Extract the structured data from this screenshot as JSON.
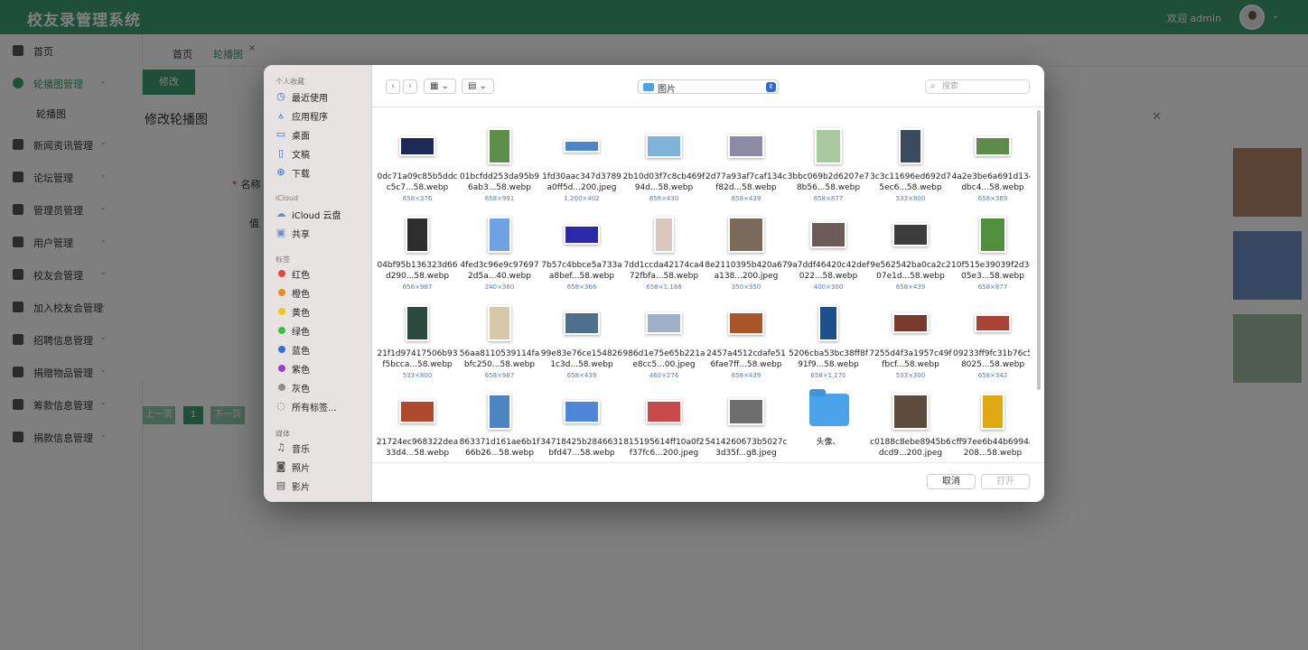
{
  "header": {
    "title": "校友录管理系统",
    "welcome": "欢迎 admin"
  },
  "sidebar": {
    "items": [
      {
        "label": "首页",
        "icon": "home-icon"
      },
      {
        "label": "轮播图管理",
        "icon": "circle-plus-icon",
        "active": true
      },
      {
        "label": "新闻资讯管理",
        "icon": "table-icon"
      },
      {
        "label": "论坛管理",
        "icon": "briefcase-icon"
      },
      {
        "label": "管理员管理",
        "icon": "bar-chart-icon"
      },
      {
        "label": "用户管理",
        "icon": "card-icon"
      },
      {
        "label": "校友会管理",
        "icon": "grid-icon"
      },
      {
        "label": "加入校友会管理",
        "icon": "mail-icon"
      },
      {
        "label": "招聘信息管理",
        "icon": "compass-icon"
      },
      {
        "label": "捐赠物品管理",
        "icon": "book-icon"
      },
      {
        "label": "筹款信息管理",
        "icon": "table-icon"
      },
      {
        "label": "捐款信息管理",
        "icon": "table-icon"
      }
    ],
    "sub_item": "轮播图"
  },
  "tabs": [
    {
      "label": "首页"
    },
    {
      "label": "轮播图"
    }
  ],
  "edit_button": "修改",
  "pager": {
    "prev": "上一页",
    "page": "1",
    "next": "下一页"
  },
  "edit_dialog": {
    "title": "修改轮播图",
    "name_label": "名称",
    "value_label": "值"
  },
  "picker": {
    "sections": {
      "favorites": "个人收藏",
      "icloud": "iCloud",
      "tags": "标签",
      "media": "媒体"
    },
    "favorites": [
      {
        "label": "最近使用",
        "icon": "clock-icon"
      },
      {
        "label": "应用程序",
        "icon": "apps-icon"
      },
      {
        "label": "桌面",
        "icon": "desktop-icon"
      },
      {
        "label": "文稿",
        "icon": "document-icon"
      },
      {
        "label": "下载",
        "icon": "download-icon"
      }
    ],
    "icloud": [
      {
        "label": "iCloud 云盘",
        "icon": "cloud-icon"
      },
      {
        "label": "共享",
        "icon": "shared-folder-icon"
      }
    ],
    "tags": [
      {
        "label": "红色",
        "color": "#e8453c"
      },
      {
        "label": "橙色",
        "color": "#f08a1c"
      },
      {
        "label": "黄色",
        "color": "#f2c811"
      },
      {
        "label": "绿色",
        "color": "#3cc13b"
      },
      {
        "label": "蓝色",
        "color": "#2f6fe0"
      },
      {
        "label": "紫色",
        "color": "#9a3fc9"
      },
      {
        "label": "灰色",
        "color": "#8e8e8e"
      },
      {
        "label": "所有标签...",
        "color": ""
      }
    ],
    "media": [
      {
        "label": "音乐",
        "icon": "music-icon"
      },
      {
        "label": "照片",
        "icon": "camera-icon"
      },
      {
        "label": "影片",
        "icon": "film-icon"
      }
    ],
    "location": "图片",
    "search_placeholder": "搜索",
    "cancel": "取消",
    "open": "打开",
    "files": [
      {
        "name": "0dc71a09c85b5ddcc5c7...58.webp",
        "dims": "658×376",
        "color": "#1e2a55"
      },
      {
        "name": "01bcfdd253da95b96ab3...58.webp",
        "dims": "658×991",
        "color": "#5d8f4a"
      },
      {
        "name": "1fd30aac347d3789a0ff5d...200.jpeg",
        "dims": "1,200×402",
        "color": "#4c86c9"
      },
      {
        "name": "2b10d03f7c8cb469f94d...58.webp",
        "dims": "658×430",
        "color": "#7fb3d8"
      },
      {
        "name": "2d77a93af7caf134cf82d...58.webp",
        "dims": "658×439",
        "color": "#8c8aa6"
      },
      {
        "name": "3bbc069b2d6207e78b56...58.webp",
        "dims": "658×877",
        "color": "#a8c9a0"
      },
      {
        "name": "3c3c11696ed692d75ec6...58.webp",
        "dims": "533×800",
        "color": "#3b4a5c"
      },
      {
        "name": "4a2e3be6a691d134dbc4...58.webp",
        "dims": "658×369",
        "color": "#5e8a4c"
      },
      {
        "name": "04bf95b136323d66d290...58.webp",
        "dims": "658×987",
        "color": "#2d2d2d"
      },
      {
        "name": "4fed3c96e9c976972d5a...40.webp",
        "dims": "240×360",
        "color": "#6fa2e4"
      },
      {
        "name": "7b57c4bbce5a733aa8bef...58.webp",
        "dims": "658×366",
        "color": "#2c2aa8"
      },
      {
        "name": "7dd1ccda42174ca472fbfa...58.webp",
        "dims": "658×1,188",
        "color": "#d9c7c0"
      },
      {
        "name": "8e2110395b420a67a138...200.jpeg",
        "dims": "350×350",
        "color": "#7a6a5a"
      },
      {
        "name": "9a7ddf46420c42def022...58.webp",
        "dims": "400×300",
        "color": "#6d5b58"
      },
      {
        "name": "9e562542ba0ca2c207e1d...58.webp",
        "dims": "658×439",
        "color": "#3c3c3c"
      },
      {
        "name": "10f515e39039f2d3d05e3...58.webp",
        "dims": "658×877",
        "color": "#4f8f3e"
      },
      {
        "name": "21f1d97417506b93f5bcca...58.webp",
        "dims": "533×800",
        "color": "#2c4a3e"
      },
      {
        "name": "56aa8110539114fabfc250...58.webp",
        "dims": "658×987",
        "color": "#d7c8a8"
      },
      {
        "name": "99e83e76ce1548261c3d...58.webp",
        "dims": "658×439",
        "color": "#4d6f8a"
      },
      {
        "name": "986d1e75e65b221ae8cc5...00.jpeg",
        "dims": "460×276",
        "color": "#9fb0c8"
      },
      {
        "name": "2457a4512cdafe516fae7ff...58.webp",
        "dims": "658×439",
        "color": "#a8552a"
      },
      {
        "name": "5206cba53bc38ff8f91f9...58.webp",
        "dims": "658×1,170",
        "color": "#1d4f8a"
      },
      {
        "name": "7255d4f3a1957c49ffbcf...58.webp",
        "dims": "533×300",
        "color": "#7a3a2c"
      },
      {
        "name": "09233ff9fc31b76c58025...58.webp",
        "dims": "658×342",
        "color": "#a84436"
      },
      {
        "name": "21724ec968322dea33d4...58.webp",
        "dims": "",
        "color": "#b04a2f"
      },
      {
        "name": "863371d161ae6b1f66b26...58.webp",
        "dims": "",
        "color": "#4d84c4"
      },
      {
        "name": "34718425b2846631bfd47...58.webp",
        "dims": "",
        "color": "#4e86d8"
      },
      {
        "name": "815195614ff10a0f2f37fc6...200.jpeg",
        "dims": "",
        "color": "#c94a4a"
      },
      {
        "name": "5414260673b5027c3d35f...g8.jpeg",
        "dims": "",
        "color": "#6e6e6e"
      },
      {
        "name": "头像、",
        "dims": "2个项目",
        "folder": true,
        "color": "#4aa3e8"
      },
      {
        "name": "c0188c8ebe8945b6dcd9...200.jpeg",
        "dims": "",
        "color": "#5c4a3a"
      },
      {
        "name": "cff97ee6b44b6994a208...58.webp",
        "dims": "",
        "color": "#e0a914"
      }
    ]
  }
}
